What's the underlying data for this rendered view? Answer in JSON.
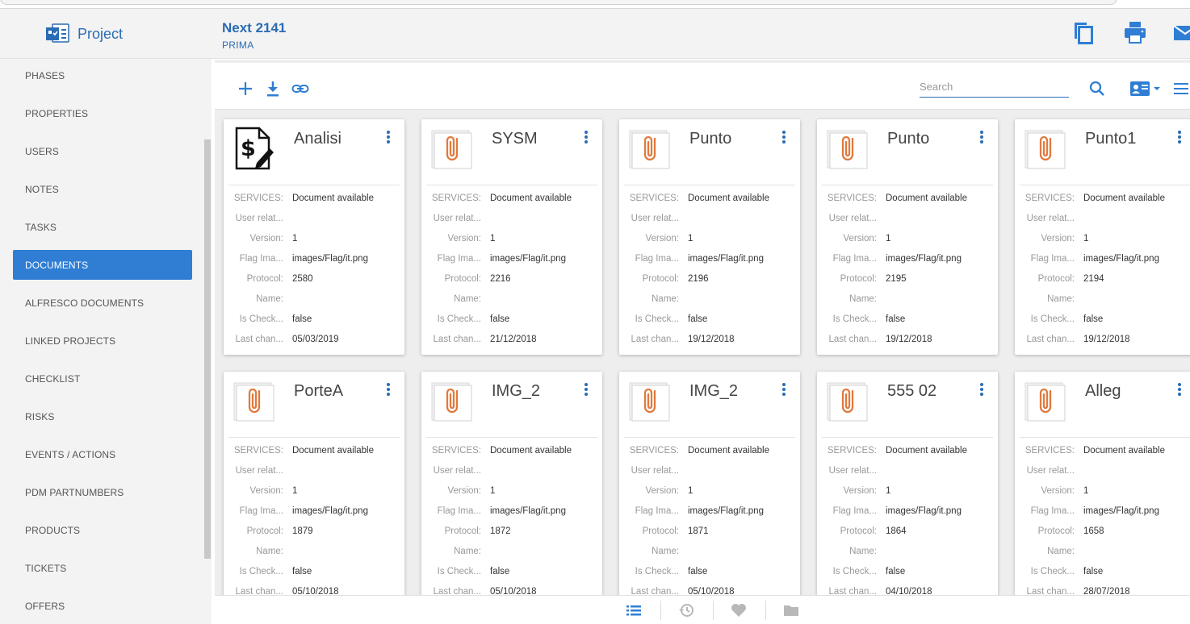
{
  "app": {
    "brand": "Project"
  },
  "project": {
    "title": "Next 2141",
    "subtitle": "PRIMA"
  },
  "header_actions": [
    {
      "icon": "copy-icon"
    },
    {
      "icon": "print-icon"
    },
    {
      "icon": "mail-icon"
    }
  ],
  "sidebar": {
    "items": [
      {
        "label": "PHASES",
        "active": false
      },
      {
        "label": "PROPERTIES",
        "active": false
      },
      {
        "label": "USERS",
        "active": false
      },
      {
        "label": "NOTES",
        "active": false
      },
      {
        "label": "TASKS",
        "active": false
      },
      {
        "label": "DOCUMENTS",
        "active": true
      },
      {
        "label": "ALFRESCO DOCUMENTS",
        "active": false
      },
      {
        "label": "LINKED PROJECTS",
        "active": false
      },
      {
        "label": "CHECKLIST",
        "active": false
      },
      {
        "label": "RISKS",
        "active": false
      },
      {
        "label": "EVENTS / ACTIONS",
        "active": false
      },
      {
        "label": "PDM PARTNUMBERS",
        "active": false
      },
      {
        "label": "PRODUCTS",
        "active": false
      },
      {
        "label": "TICKETS",
        "active": false
      },
      {
        "label": "OFFERS",
        "active": false
      }
    ]
  },
  "toolbar": {
    "icons": [
      "add-icon",
      "download-icon",
      "link-icon"
    ],
    "search_placeholder": "Search",
    "right_icons": [
      "search-icon",
      "card-view-icon",
      "list-view-icon"
    ]
  },
  "field_labels": {
    "services": "SERVICES:",
    "user": "User relat...",
    "version": "Version:",
    "flag": "Flag Ima...",
    "protocol": "Protocol:",
    "name": "Name:",
    "checked": "Is Check...",
    "last": "Last chan..."
  },
  "documents": [
    {
      "title": "Analisi",
      "thumb": "money-doc-icon",
      "services": "Document available",
      "user": "",
      "version": "1",
      "flag": "images/Flag/it.png",
      "protocol": "2580",
      "name": "",
      "checked": "false",
      "last": "05/03/2019"
    },
    {
      "title": "SYSM",
      "thumb": "paperclip-icon",
      "services": "Document available",
      "user": "",
      "version": "1",
      "flag": "images/Flag/it.png",
      "protocol": "2216",
      "name": "",
      "checked": "false",
      "last": "21/12/2018"
    },
    {
      "title": "Punto",
      "thumb": "paperclip-icon",
      "services": "Document available",
      "user": "",
      "version": "1",
      "flag": "images/Flag/it.png",
      "protocol": "2196",
      "name": "",
      "checked": "false",
      "last": "19/12/2018"
    },
    {
      "title": "Punto",
      "thumb": "paperclip-icon",
      "services": "Document available",
      "user": "",
      "version": "1",
      "flag": "images/Flag/it.png",
      "protocol": "2195",
      "name": "",
      "checked": "false",
      "last": "19/12/2018"
    },
    {
      "title": "Punto1",
      "thumb": "paperclip-icon",
      "services": "Document available",
      "user": "",
      "version": "1",
      "flag": "images/Flag/it.png",
      "protocol": "2194",
      "name": "",
      "checked": "false",
      "last": "19/12/2018"
    },
    {
      "title": "PorteA",
      "thumb": "paperclip-icon",
      "services": "Document available",
      "user": "",
      "version": "1",
      "flag": "images/Flag/it.png",
      "protocol": "1879",
      "name": "",
      "checked": "false",
      "last": "05/10/2018"
    },
    {
      "title": "IMG_2",
      "thumb": "paperclip-icon",
      "services": "Document available",
      "user": "",
      "version": "1",
      "flag": "images/Flag/it.png",
      "protocol": "1872",
      "name": "",
      "checked": "false",
      "last": "05/10/2018"
    },
    {
      "title": "IMG_2",
      "thumb": "paperclip-icon",
      "services": "Document available",
      "user": "",
      "version": "1",
      "flag": "images/Flag/it.png",
      "protocol": "1871",
      "name": "",
      "checked": "false",
      "last": "05/10/2018"
    },
    {
      "title": "555 02",
      "thumb": "paperclip-icon",
      "services": "Document available",
      "user": "",
      "version": "1",
      "flag": "images/Flag/it.png",
      "protocol": "1864",
      "name": "",
      "checked": "false",
      "last": "04/10/2018"
    },
    {
      "title": "Alleg",
      "thumb": "paperclip-icon",
      "services": "Document available",
      "user": "",
      "version": "1",
      "flag": "images/Flag/it.png",
      "protocol": "1658",
      "name": "",
      "checked": "false",
      "last": "28/07/2018"
    }
  ],
  "bottom_bar": {
    "icons": [
      "list-icon",
      "history-icon",
      "favorite-icon",
      "folder-icon"
    ]
  },
  "colors": {
    "accent": "#2f7ed4",
    "brand_text": "#2a6cb4",
    "clip": "#e07a3e"
  }
}
